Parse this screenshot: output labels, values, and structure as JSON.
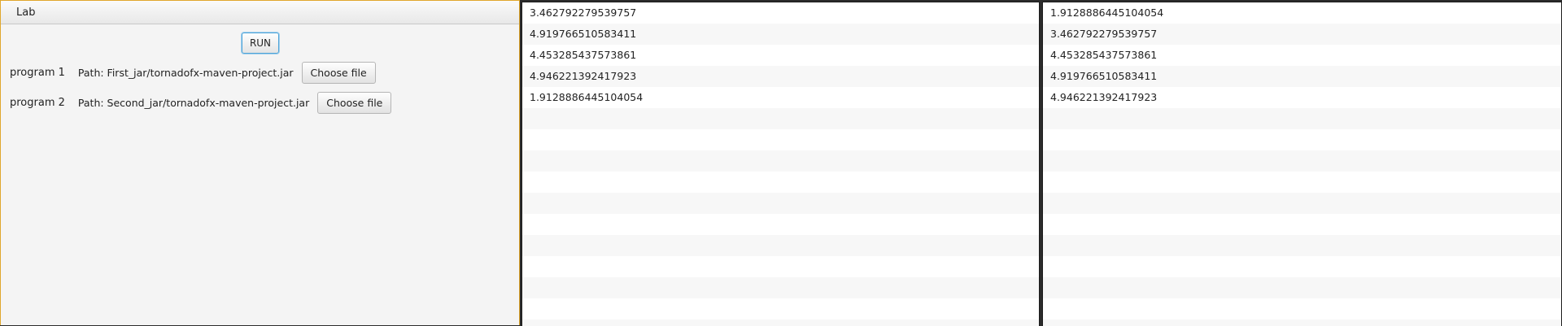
{
  "menu": {
    "items": [
      "Lab"
    ]
  },
  "controls": {
    "run_label": "RUN",
    "programs": [
      {
        "label": "program 1",
        "path": "Path: First_jar/tornadofx-maven-project.jar",
        "button": "Choose file"
      },
      {
        "label": "program 2",
        "path": "Path: Second_jar/tornadofx-maven-project.jar",
        "button": "Choose file"
      }
    ]
  },
  "results": {
    "list1": [
      "3.462792279539757",
      "4.919766510583411",
      "4.453285437573861",
      "4.946221392417923",
      "1.9128886445104054"
    ],
    "list2": [
      "1.9128886445104054",
      "3.462792279539757",
      "4.453285437573861",
      "4.919766510583411",
      "4.946221392417923"
    ]
  },
  "colors": {
    "focus_border": "#e0a72c",
    "button_focus": "#4da3d8"
  }
}
